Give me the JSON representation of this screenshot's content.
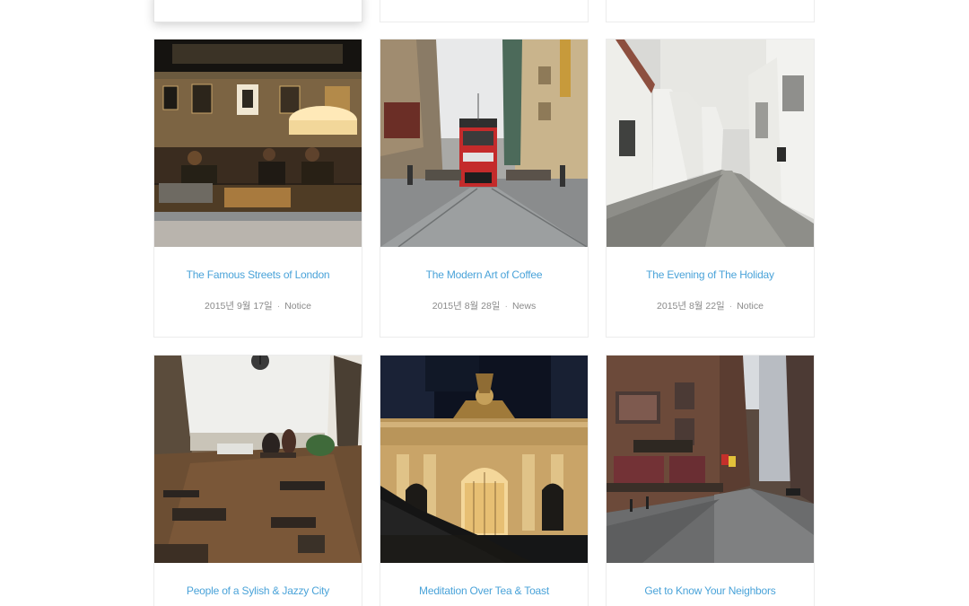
{
  "posts": [
    {
      "title": "The Famous Streets of London",
      "date": "2015년 9월 17일",
      "category": "Notice"
    },
    {
      "title": "The Modern Art of Coffee",
      "date": "2015년 8월 28일",
      "category": "News"
    },
    {
      "title": "The Evening of The Holiday",
      "date": "2015년 8월 22일",
      "category": "Notice"
    },
    {
      "title": "People of a Sylish & Jazzy City"
    },
    {
      "title": "Meditation Over Tea & Toast"
    },
    {
      "title": "Get to Know Your Neighbors"
    }
  ],
  "separator": "·",
  "colors": {
    "title": "#4aa3d9",
    "meta": "#8a8a8a",
    "border": "#ececec"
  }
}
